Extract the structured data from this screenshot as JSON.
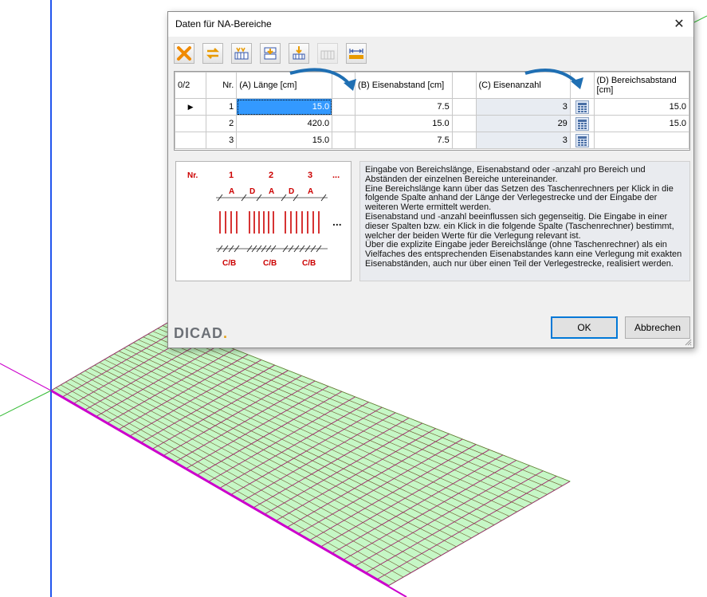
{
  "dialog": {
    "title": "Daten für NA-Bereiche",
    "close_symbol": "✕",
    "toolbar": [
      "delete-icon",
      "swap-icon",
      "insert-rows-icon",
      "insert-row-above-icon",
      "insert-row-below-icon",
      "disabled-rows-icon",
      "dimension-icon"
    ],
    "grid": {
      "corner": "0/2",
      "headers": {
        "nr": "Nr.",
        "length": "(A) Länge [cm]",
        "spacing": "(B) Eisenabstand [cm]",
        "count": "(C) Eisenanzahl",
        "distance": "(D) Bereichsabstand [cm]"
      },
      "rows": [
        {
          "nr": "1",
          "length": "15.0",
          "spacing": "7.5",
          "count": "3",
          "distance": "15.0"
        },
        {
          "nr": "2",
          "length": "420.0",
          "spacing": "15.0",
          "count": "29",
          "distance": "15.0"
        },
        {
          "nr": "3",
          "length": "15.0",
          "spacing": "7.5",
          "count": "3",
          "distance": ""
        }
      ]
    },
    "diagram": {
      "nr_label": "Nr.",
      "numbers": [
        "1",
        "2",
        "3",
        "..."
      ],
      "labels": [
        "A",
        "D",
        "A",
        "D",
        "A"
      ],
      "bottom_labels": [
        "C/B",
        "C/B",
        "C/B"
      ],
      "dots": "..."
    },
    "description": [
      "Eingabe von Bereichslänge, Eisenabstand oder -anzahl pro Bereich und Abständen der einzelnen Bereiche untereinander.",
      "Eine Bereichslänge kann über das Setzen des Taschenrechners per Klick in die folgende Spalte anhand der Länge der Verlegestrecke und der Eingabe der weiteren Werte ermittelt werden.",
      "Eisenabstand und -anzahl beeinflussen sich gegenseitig. Die Eingabe in einer dieser Spalten bzw. ein Klick in die folgende Spalte (Taschenrechner) bestimmt, welcher der beiden Werte für die Verlegung relevant ist.",
      "Über die explizite Eingabe jeder Bereichslänge (ohne Taschenrechner) als ein Vielfaches des entsprechenden Eisenabstandes kann eine Verlegung mit exakten Eisenabständen, auch nur über einen Teil der Verlegestrecke, realisiert werden."
    ],
    "logo": {
      "text": "DICAD",
      "dot": "."
    },
    "ok_label": "OK",
    "cancel_label": "Abbrechen"
  },
  "colors": {
    "accent": "#0078d7",
    "selection": "#3399ff",
    "mesh_fill": "#c6f7c6",
    "mesh_lines": "#a0236e",
    "axis_blue": "#2255ee",
    "axis_magenta": "#cc00cc",
    "axis_green": "#33bb33"
  }
}
